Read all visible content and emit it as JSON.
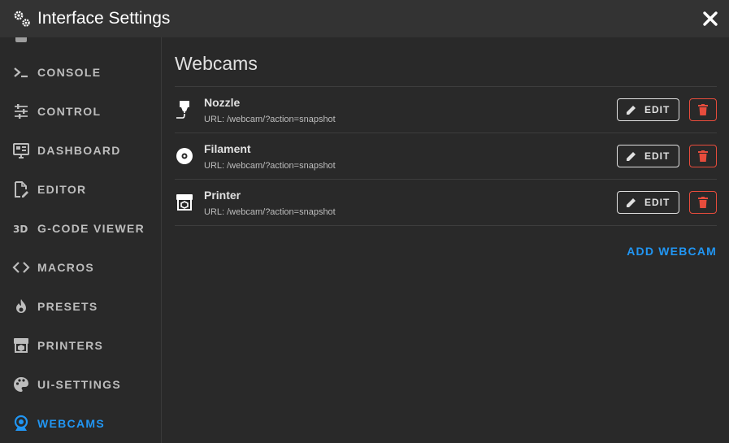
{
  "dialog": {
    "title": "Interface Settings",
    "title_icon": "gears-icon",
    "close_icon": "close-icon"
  },
  "sidebar": {
    "items": [
      {
        "label": "CONSOLE",
        "icon": "console-icon"
      },
      {
        "label": "CONTROL",
        "icon": "tune-icon"
      },
      {
        "label": "DASHBOARD",
        "icon": "monitor-dashboard-icon"
      },
      {
        "label": "EDITOR",
        "icon": "file-edit-icon"
      },
      {
        "label": "G-CODE VIEWER",
        "icon": "3d-icon"
      },
      {
        "label": "MACROS",
        "icon": "code-brackets-icon"
      },
      {
        "label": "PRESETS",
        "icon": "fire-icon"
      },
      {
        "label": "PRINTERS",
        "icon": "printer-3d-icon"
      },
      {
        "label": "UI-SETTINGS",
        "icon": "palette-icon"
      },
      {
        "label": "WEBCAMS",
        "icon": "webcam-icon",
        "active": true
      }
    ]
  },
  "main": {
    "title": "Webcams",
    "webcams": [
      {
        "name": "Nozzle",
        "url": "URL: /webcam/?action=snapshot",
        "icon": "nozzle-icon"
      },
      {
        "name": "Filament",
        "url": "URL: /webcam/?action=snapshot",
        "icon": "filament-spool-icon"
      },
      {
        "name": "Printer",
        "url": "URL: /webcam/?action=snapshot",
        "icon": "printer-3d-icon"
      }
    ],
    "edit_label": "EDIT",
    "add_label": "ADD WEBCAM"
  },
  "colors": {
    "accent": "#2196f3",
    "danger": "#e74c3c",
    "background": "#292929",
    "titlebar": "#333333"
  }
}
